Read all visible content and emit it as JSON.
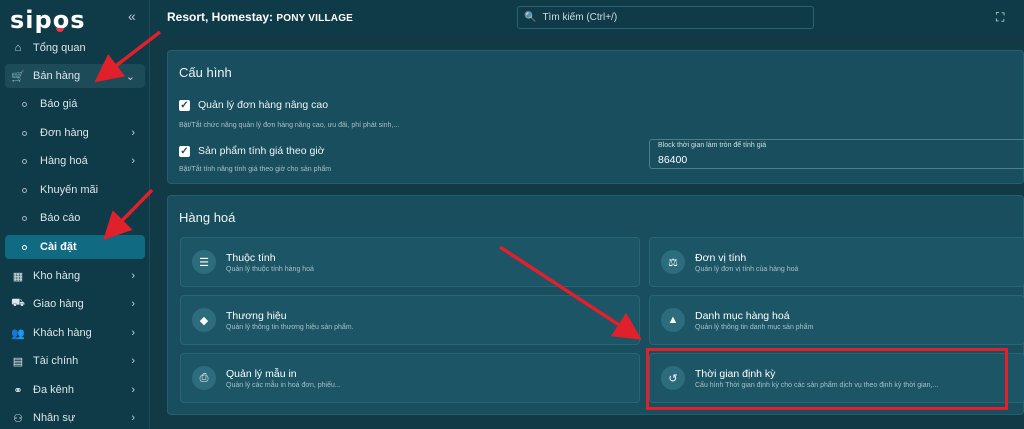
{
  "brand": {
    "logo_text_1": "sip",
    "logo_text_2": "o",
    "logo_text_3": "s"
  },
  "sidebar": {
    "collapse_icon": "double-chevron-left-icon",
    "items": [
      {
        "label": "Tổng quan",
        "icon": "home-icon"
      },
      {
        "label": "Bán hàng",
        "icon": "cart-icon"
      },
      {
        "label": "Báo giá"
      },
      {
        "label": "Đơn hàng"
      },
      {
        "label": "Hàng hoá"
      },
      {
        "label": "Khuyến mãi"
      },
      {
        "label": "Báo cáo"
      },
      {
        "label": "Cài đặt"
      },
      {
        "label": "Kho hàng",
        "icon": "warehouse-icon"
      },
      {
        "label": "Giao hàng",
        "icon": "truck-icon"
      },
      {
        "label": "Khách hàng",
        "icon": "users-icon"
      },
      {
        "label": "Tài chính",
        "icon": "calculator-icon"
      },
      {
        "label": "Đa kênh",
        "icon": "channels-icon"
      },
      {
        "label": "Nhân sự",
        "icon": "staff-icon"
      }
    ]
  },
  "header": {
    "title": "Resort, Homestay:",
    "title_name": "PONY VILLAGE",
    "search_placeholder": "Tìm kiếm (Ctrl+/)"
  },
  "config": {
    "title": "Cấu hình",
    "advanced_orders_label": "Quản lý đơn hàng nâng cao",
    "advanced_orders_hint": "Bật/Tắt chức năng quản lý đơn hàng nâng cao, ưu đãi, phí phát sinh,...",
    "hourly_price_label": "Sản phẩm tính giá theo giờ",
    "hourly_price_hint": "Bật/Tắt tính năng tính giá theo giờ cho sản phẩm",
    "block_label": "Block thời gian làm tròn để tính giá",
    "block_value": "86400"
  },
  "goods": {
    "title": "Hàng hoá",
    "cards": [
      {
        "title": "Thuộc tính",
        "desc": "Quản lý thuộc tính hàng hoá",
        "icon": "list-icon"
      },
      {
        "title": "Đơn vị tính",
        "desc": "Quản lý đơn vị tính của hàng hoá",
        "icon": "scale-icon"
      },
      {
        "title": "Thương hiệu",
        "desc": "Quản lý thông tin thương hiệu sản phẩm.",
        "icon": "tag-icon"
      },
      {
        "title": "Danh mục hàng hoá",
        "desc": "Quản lý thông tin danh mục sản phẩm",
        "icon": "category-icon"
      },
      {
        "title": "Quản lý mẫu in",
        "desc": "Quản lý các mẫu in hoá đơn, phiếu...",
        "icon": "printer-icon"
      },
      {
        "title": "Thời gian định kỳ",
        "desc": "Cấu hình Thời gian định kỳ cho các sản phẩm dịch vụ theo định kỳ thời gian,...",
        "icon": "history-icon"
      }
    ]
  },
  "colors": {
    "annotation_red": "#e0202a",
    "active_item": "#0f6a82"
  }
}
